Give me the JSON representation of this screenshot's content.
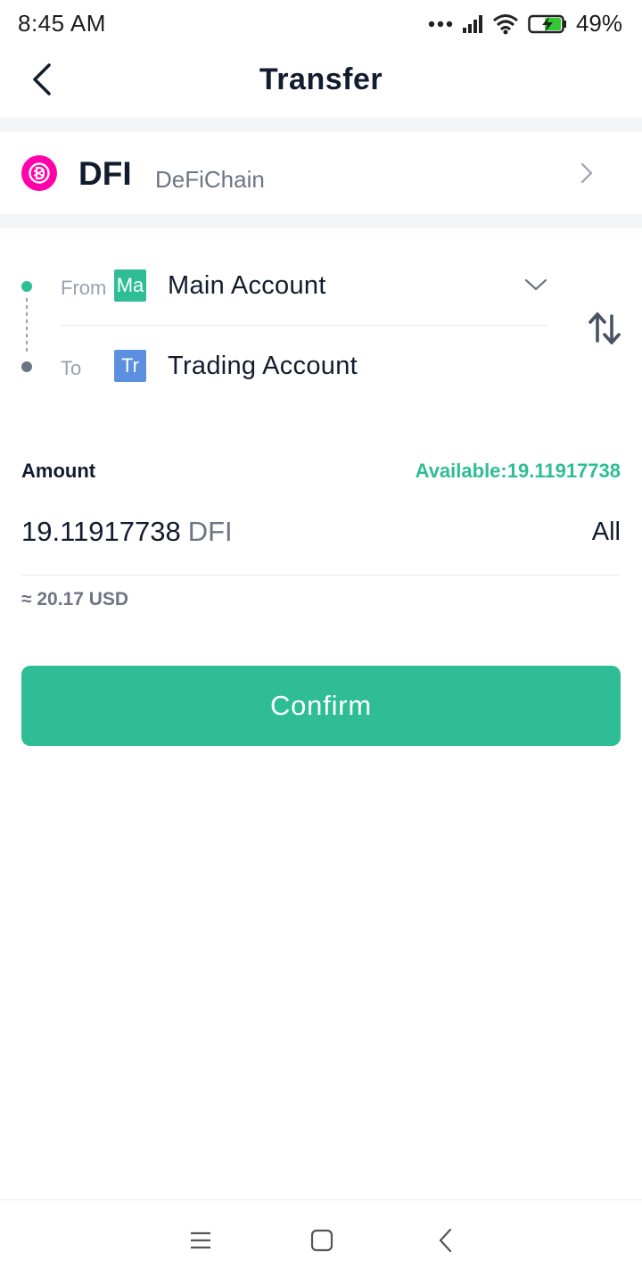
{
  "status_bar": {
    "time": "8:45  AM",
    "battery_percent": "49%",
    "icons": [
      "dots-icon",
      "signal-icon",
      "wifi-icon",
      "battery-charging-icon"
    ]
  },
  "header": {
    "title": "Transfer",
    "back_icon": "back-chevron-icon"
  },
  "coin": {
    "symbol": "DFI",
    "chain": "DeFiChain",
    "icon_color": "#ff00aa"
  },
  "transfer": {
    "from_label": "From",
    "from_badge": "Ma",
    "from_account": "Main Account",
    "to_label": "To",
    "to_badge": "Tr",
    "to_account": "Trading Account"
  },
  "amount": {
    "label": "Amount",
    "available": "Available:19.11917738",
    "value": "19.11917738",
    "unit": "DFI",
    "all_label": "All",
    "usd_approx": "≈ 20.17 USD"
  },
  "confirm_label": "Confirm",
  "colors": {
    "accent": "#2ebd95",
    "text_primary": "#121c2f",
    "text_secondary": "#6d7584",
    "trading_badge": "#5b8fe0"
  },
  "nav_bar": {
    "icons": [
      "menu-icon",
      "home-square-icon",
      "back-triangle-icon"
    ]
  }
}
